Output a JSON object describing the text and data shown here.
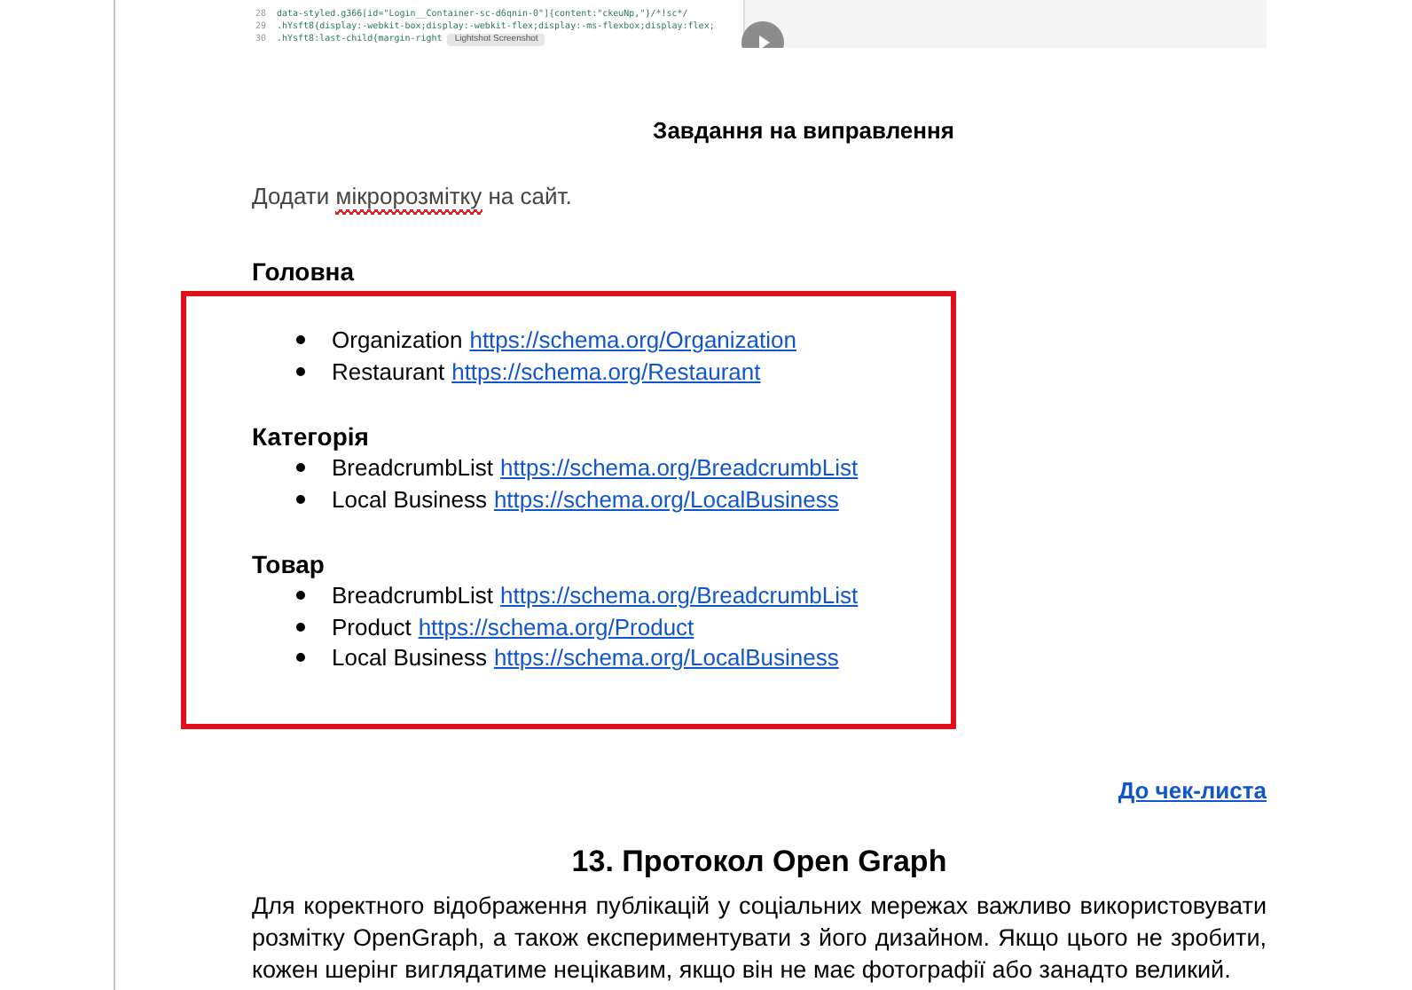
{
  "code_image": {
    "lines": [
      {
        "number": "28",
        "code": "data-styled.g366[id=\"Login__Container-sc-d6qnin-0\"]{content:\"ckeuNp,\"}/*!sc*/"
      },
      {
        "number": "29",
        "code": ".hYsft8{display:-webkit-box;display:-webkit-flex;display:-ms-flexbox;display:flex;"
      },
      {
        "number": "30",
        "code": ".hYsft8:last-child{margin-right"
      }
    ],
    "tooltip": "Lightshot Screenshot"
  },
  "task_heading": "Завдання на виправлення",
  "intro": [
    {
      "text": "Додати ",
      "misspelled": false
    },
    {
      "text": "мікророзмітку",
      "misspelled": true
    },
    {
      "text": " на сайт.",
      "misspelled": false
    }
  ],
  "sections": [
    {
      "title": "Головна",
      "items": [
        {
          "name": "Organization",
          "url": "https://schema.org/Organization"
        },
        {
          "name": "Restaurant",
          "url": "https://schema.org/Restaurant"
        }
      ]
    },
    {
      "title": "Категорія",
      "items": [
        {
          "name": "BreadcrumbList",
          "url": "https://schema.org/BreadcrumbList"
        },
        {
          "name": "Local Business",
          "url": "https://schema.org/LocalBusiness"
        }
      ]
    },
    {
      "title": "Товар",
      "items": [
        {
          "name": "BreadcrumbList",
          "url": "https://schema.org/BreadcrumbList"
        },
        {
          "name": "Product",
          "url": "https://schema.org/Product"
        },
        {
          "name": "Local Business",
          "url": "https://schema.org/LocalBusiness"
        }
      ]
    }
  ],
  "checklist_link": "До чек-листа",
  "section_heading": "13. Протокол Open Graph",
  "body": "Для коректного відображення публікацій у соціальних мережах важливо використовувати розмітку OpenGraph, а також експериментувати з його дизайном. Якщо цього не зробити, кожен шерінг виглядатиме нецікавим, якщо він не має фотографії або занадто великий."
}
